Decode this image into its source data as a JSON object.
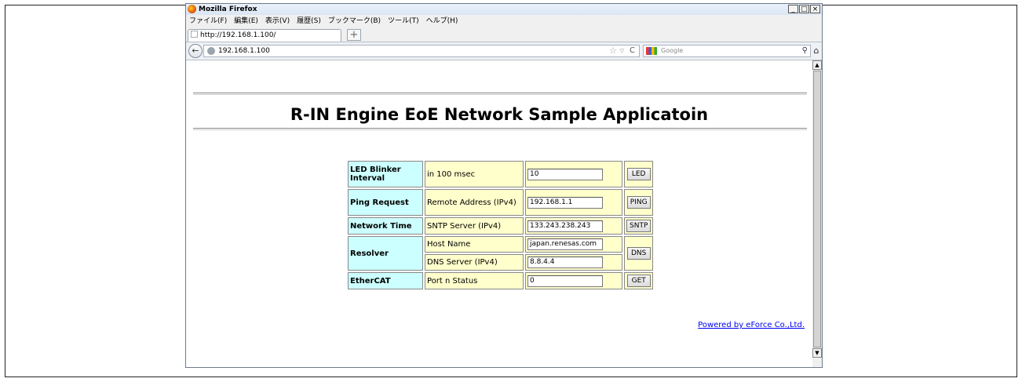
{
  "window": {
    "title": "Mozilla Firefox",
    "buttons": {
      "minimize": "_",
      "maximize": "□",
      "close": "×"
    }
  },
  "menu": [
    "ファイル(F)",
    "編集(E)",
    "表示(V)",
    "履歴(S)",
    "ブックマーク(B)",
    "ツール(T)",
    "ヘルプ(H)"
  ],
  "tab": {
    "label": "http://192.168.1.100/",
    "new_tab": "+"
  },
  "nav": {
    "back": "←",
    "url": "192.168.1.100",
    "star": "☆",
    "dropdown": "▽",
    "reload": "C",
    "search_placeholder": "Google",
    "search_icon": "⚲",
    "home": "⌂",
    "icons": {
      "back": "back-arrow-icon",
      "site": "globe-icon",
      "search_engine": "google-icon",
      "home": "home-icon"
    }
  },
  "page": {
    "heading": "R-IN Engine EoE Network Sample Applicatoin",
    "rows": {
      "led": {
        "label": "LED Blinker Interval",
        "desc": "in 100 msec",
        "value": "10",
        "button": "LED"
      },
      "ping": {
        "label": "Ping Request",
        "desc": "Remote Address (IPv4)",
        "value": "192.168.1.1",
        "button": "PING"
      },
      "ntp": {
        "label": "Network Time",
        "desc": "SNTP Server (IPv4)",
        "value": "133.243.238.243",
        "button": "SNTP"
      },
      "resolver": {
        "label": "Resolver",
        "host_desc": "Host Name",
        "host_value": "japan.renesas.com",
        "dns_desc": "DNS Server (IPv4)",
        "dns_value": "8.8.4.4",
        "button": "DNS"
      },
      "ethercat": {
        "label": "EtherCAT",
        "desc": "Port n Status",
        "value": "0",
        "button": "GET"
      }
    },
    "footer_link": "Powered by eForce Co.,Ltd."
  },
  "scrollbar": {
    "up": "▲",
    "down": "▼"
  }
}
